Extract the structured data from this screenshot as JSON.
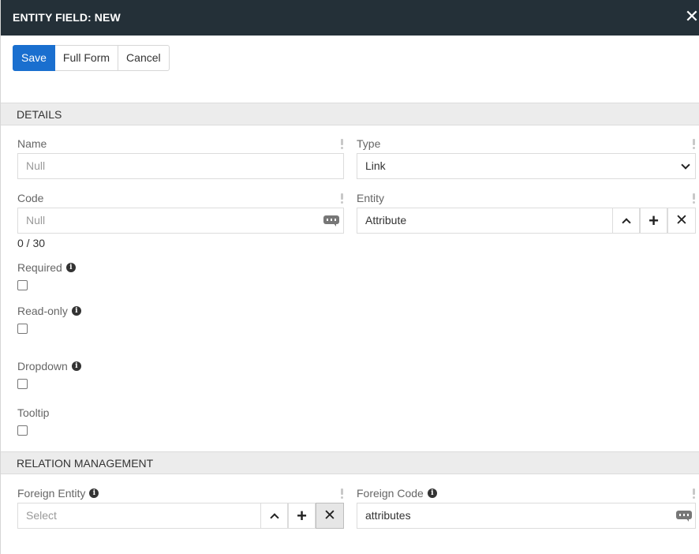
{
  "header": {
    "title": "ENTITY FIELD: NEW",
    "close_glyph": "✕"
  },
  "toolbar": {
    "save_label": "Save",
    "full_form_label": "Full Form",
    "cancel_label": "Cancel",
    "accent_color": "#1a6fcf"
  },
  "sections": {
    "details": "DETAILS",
    "relation": "RELATION MANAGEMENT"
  },
  "fields": {
    "name": {
      "label": "Name",
      "value": "Null"
    },
    "type": {
      "label": "Type",
      "value": "Link"
    },
    "code": {
      "label": "Code",
      "value": "Null",
      "counter": "0 / 30"
    },
    "entity": {
      "label": "Entity",
      "value": "Attribute"
    },
    "required": {
      "label": "Required",
      "checked": false
    },
    "read_only": {
      "label": "Read-only",
      "checked": false
    },
    "dropdown": {
      "label": "Dropdown",
      "checked": false
    },
    "tooltip": {
      "label": "Tooltip",
      "checked": false
    },
    "foreign_entity": {
      "label": "Foreign Entity",
      "placeholder": "Select"
    },
    "foreign_code": {
      "label": "Foreign Code",
      "value": "attributes"
    }
  },
  "icons": {
    "info": "i",
    "plus": "+",
    "times": "✕",
    "header_bg": "#243038"
  }
}
